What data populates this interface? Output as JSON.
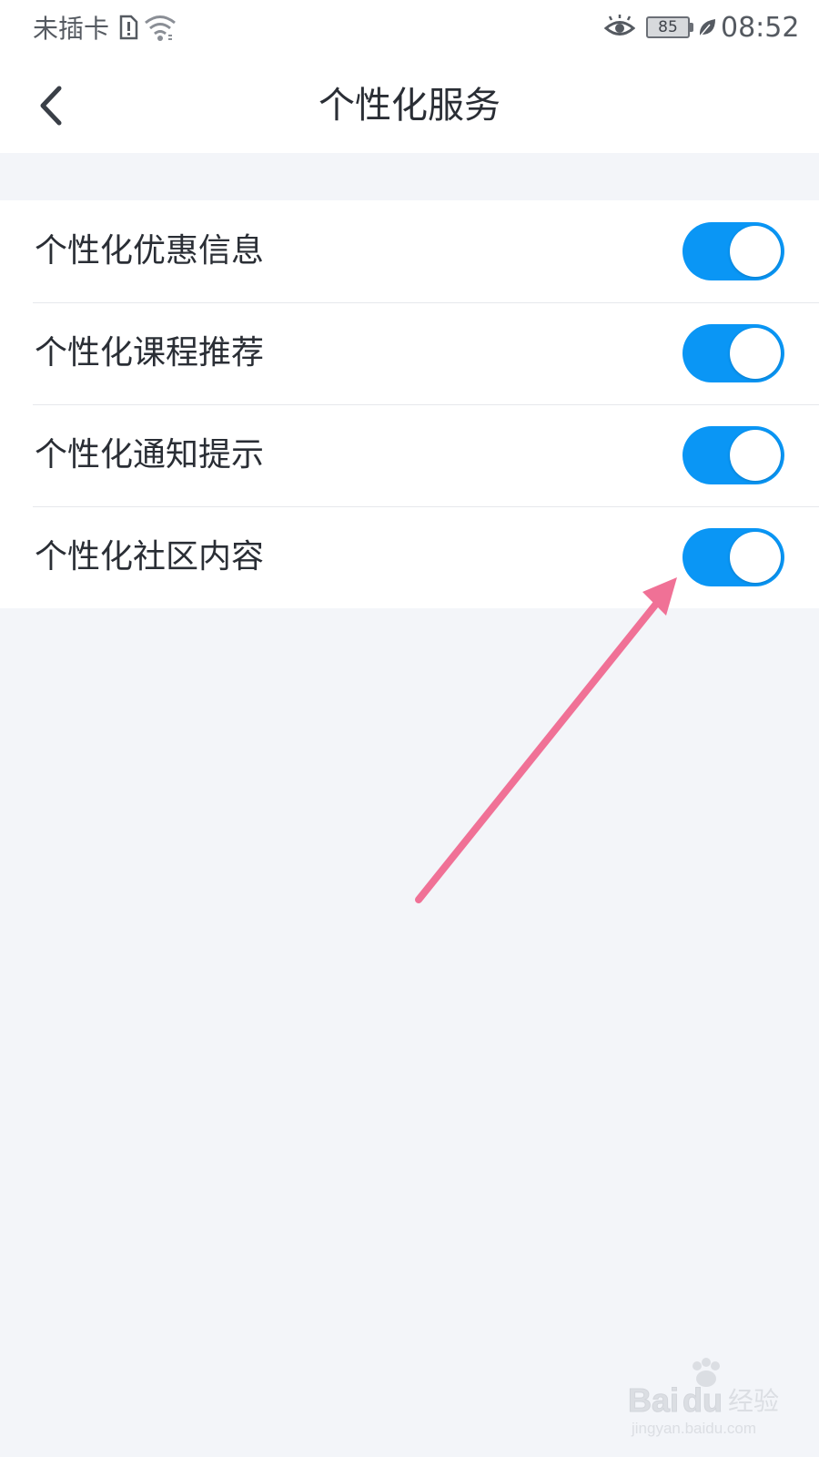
{
  "status_bar": {
    "carrier": "未插卡",
    "battery_level": "85",
    "time": "08:52",
    "icons": [
      "sim-alert-icon",
      "wifi-icon",
      "eye-comfort-icon",
      "leaf-icon"
    ]
  },
  "header": {
    "back_icon": "chevron-left-icon",
    "title": "个性化服务"
  },
  "settings": [
    {
      "label": "个性化优惠信息",
      "enabled": true
    },
    {
      "label": "个性化课程推荐",
      "enabled": true
    },
    {
      "label": "个性化通知提示",
      "enabled": true
    },
    {
      "label": "个性化社区内容",
      "enabled": true
    }
  ],
  "colors": {
    "toggle_on": "#0a96f5",
    "annotation_arrow": "#f07196",
    "page_background": "#f3f5f9"
  },
  "watermark": {
    "brand": "Bai du 经验",
    "url": "jingyan.baidu.com"
  }
}
